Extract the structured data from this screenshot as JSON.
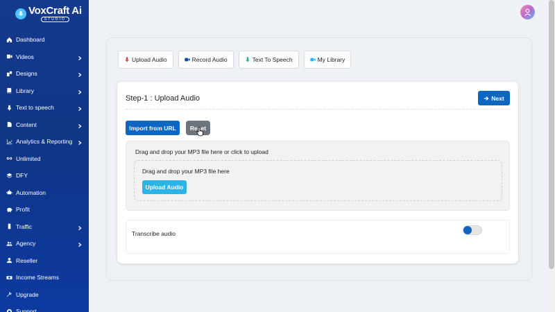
{
  "brand": {
    "name": "VoxCraft Ai",
    "sub": "STUDIO"
  },
  "sidebar": {
    "items": [
      {
        "label": "Dashboard",
        "icon": "home-icon",
        "has_chevron": false
      },
      {
        "label": "Videos",
        "icon": "video-icon",
        "has_chevron": true
      },
      {
        "label": "Designs",
        "icon": "designs-icon",
        "has_chevron": true
      },
      {
        "label": "Library",
        "icon": "book-icon",
        "has_chevron": true
      },
      {
        "label": "Text to speech",
        "icon": "microphone-icon",
        "has_chevron": true
      },
      {
        "label": "Content",
        "icon": "file-icon",
        "has_chevron": true
      },
      {
        "label": "Analytics & Reporting",
        "icon": "chart-icon",
        "has_chevron": true
      },
      {
        "label": "Unlimited",
        "icon": "infinity-icon",
        "has_chevron": false
      },
      {
        "label": "DFY",
        "icon": "layers-icon",
        "has_chevron": false
      },
      {
        "label": "Automation",
        "icon": "robot-icon",
        "has_chevron": false
      },
      {
        "label": "Profit",
        "icon": "piggy-bank-icon",
        "has_chevron": false
      },
      {
        "label": "Traffic",
        "icon": "traffic-light-icon",
        "has_chevron": true
      },
      {
        "label": "Agency",
        "icon": "users-icon",
        "has_chevron": true
      },
      {
        "label": "Reseller",
        "icon": "user-icon",
        "has_chevron": false
      },
      {
        "label": "Income Streams",
        "icon": "money-icon",
        "has_chevron": false
      },
      {
        "label": "Upgrade",
        "icon": "wrench-icon",
        "has_chevron": false
      },
      {
        "label": "Support",
        "icon": "support-icon",
        "has_chevron": false
      }
    ]
  },
  "tabs": [
    {
      "label": "Upload Audio",
      "icon": "microphone-icon",
      "icon_color": "#e53935"
    },
    {
      "label": "Record Audio",
      "icon": "video-camera-icon",
      "icon_color": "#0d47a1"
    },
    {
      "label": "Text To Speech",
      "icon": "microphone-icon",
      "icon_color": "#26a69a"
    },
    {
      "label": "My Library",
      "icon": "video-camera-icon",
      "icon_color": "#29b6f6"
    }
  ],
  "card": {
    "title": "Step-1 : Upload Audio",
    "next_label": "Next",
    "import_label": "Import from URL",
    "reset_label": "Reset",
    "upload_title": "Drag and drop your MP3 file here or click to upload",
    "drop_text": "Drag and drop your MP3 file here",
    "upload_button": "Upload Audio",
    "transcribe_label": "Transcribe audio",
    "transcribe_enabled": false
  },
  "colors": {
    "sidebar_bg": "#0f3585",
    "primary": "#0d66c2",
    "upload_button": "#2cb3e8",
    "reset_button": "#6c757d"
  }
}
